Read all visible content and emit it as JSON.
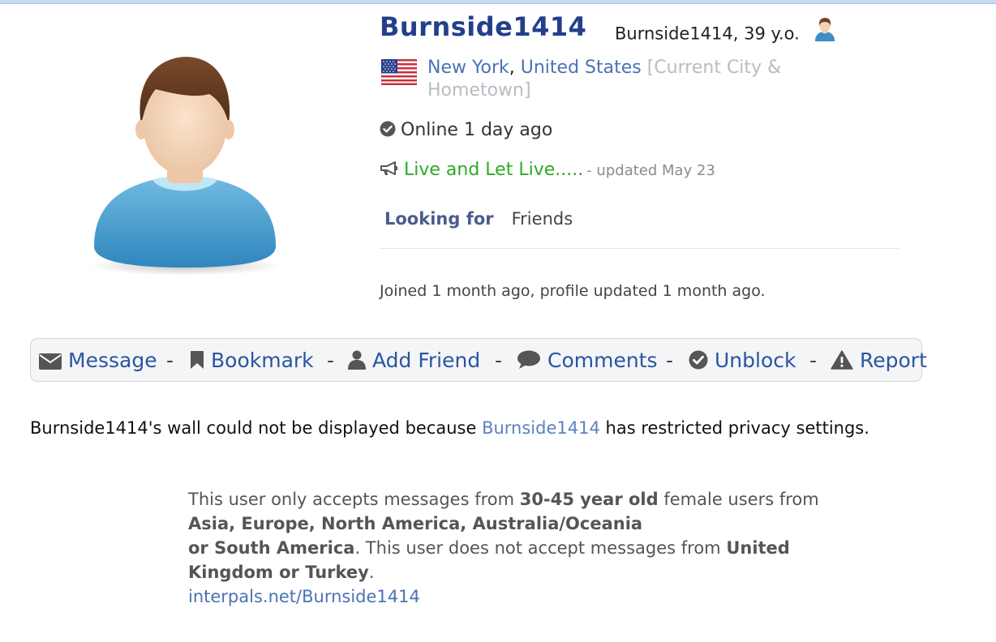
{
  "profile": {
    "username": "Burnside1414",
    "display_name": "Burnside1414, 39 y.o.",
    "city": "New York",
    "country": "United States",
    "location_note": "[Current City & Hometown]",
    "online_status": "Online 1 day ago",
    "status_message": "Live and Let Live.....",
    "status_updated": "- updated May 23",
    "looking_for_label": "Looking for",
    "looking_for_value": "Friends",
    "joined_text": "Joined 1 month ago, profile updated 1 month ago."
  },
  "actions": [
    {
      "label": "Message",
      "icon": "envelope-icon"
    },
    {
      "label": "Bookmark",
      "icon": "bookmark-icon"
    },
    {
      "label": "Add Friend",
      "icon": "user-icon"
    },
    {
      "label": "Comments",
      "icon": "comment-icon"
    },
    {
      "label": "Unblock",
      "icon": "check-circle-icon"
    },
    {
      "label": "Report",
      "icon": "warning-icon"
    }
  ],
  "action_separator": "-",
  "wall": {
    "prefix": "Burnside1414's wall could not be displayed because ",
    "link": "Burnside1414",
    "suffix": " has restricted privacy settings."
  },
  "restrictions": {
    "t1": "This user only accepts messages from ",
    "b1": "30-45 year old",
    "t2": " female users from ",
    "b2": "Asia, Europe, North America, Australia/Oceania",
    "b3": "or South America",
    "t3": ". This user does not accept messages from ",
    "b4": "United Kingdom or Turkey",
    "t4": ".",
    "profile_url": "interpals.net/Burnside1414"
  },
  "colors": {
    "username": "#233f8c",
    "link": "#4a72b5",
    "status_green": "#2eab25",
    "action_link": "#2a55a0"
  }
}
